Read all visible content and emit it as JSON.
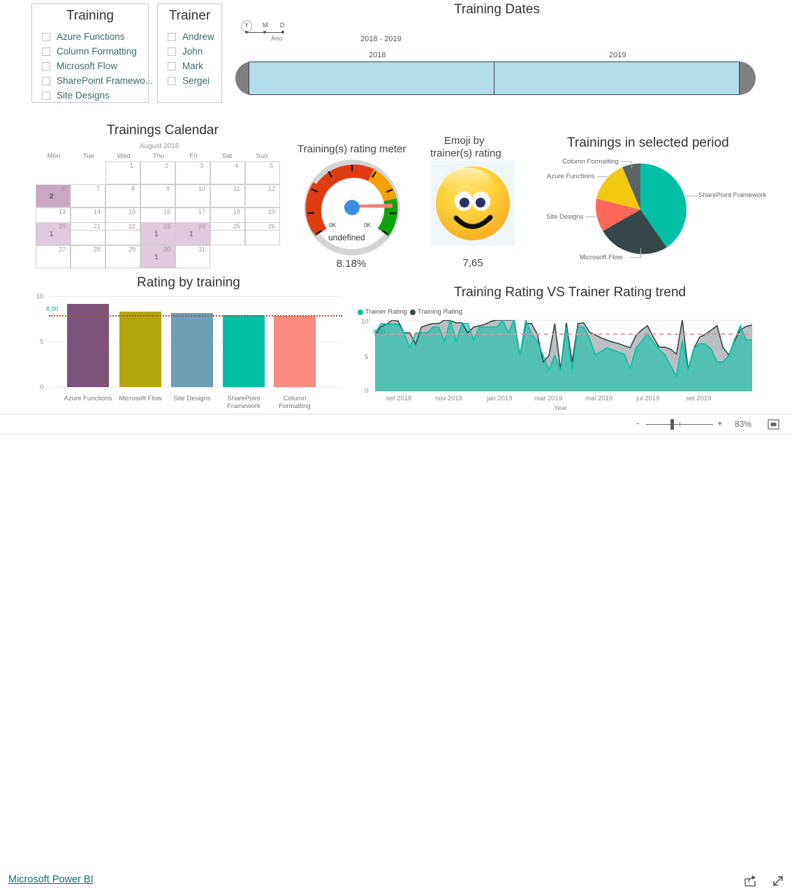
{
  "slicers": {
    "training": {
      "title": "Training",
      "items": [
        "Azure Functions",
        "Column Formatting",
        "Microsoft Flow",
        "SharePoint Framewo...",
        "Site Designs"
      ]
    },
    "trainer": {
      "title": "Trainer",
      "items": [
        "Andrew",
        "John",
        "Mark",
        "Sergei"
      ]
    }
  },
  "timeline": {
    "title": "Training Dates",
    "granularity": {
      "options": [
        "Y",
        "M",
        "D"
      ],
      "selected": "Y",
      "label": "Ano"
    },
    "range": "2018 - 2019",
    "periods": [
      "2018",
      "2019"
    ]
  },
  "calendar": {
    "title": "Trainings Calendar",
    "month": "August 2018",
    "dow": [
      "Mon",
      "Tue",
      "Wed",
      "Thu",
      "Fri",
      "Sat",
      "Sun"
    ],
    "weeks": [
      [
        null,
        null,
        1,
        2,
        3,
        4,
        5
      ],
      [
        6,
        7,
        8,
        9,
        10,
        11,
        12
      ],
      [
        13,
        14,
        15,
        16,
        17,
        18,
        19
      ],
      [
        20,
        21,
        22,
        23,
        24,
        25,
        26
      ],
      [
        27,
        28,
        29,
        30,
        31,
        null,
        null
      ]
    ],
    "counts": {
      "6": 2,
      "20": 1,
      "23": 1,
      "24": 1,
      "30": 1
    }
  },
  "gauge": {
    "title": "Training(s) rating meter",
    "min_label": "0K",
    "max_label": "0K",
    "center_label": "undefined",
    "value": "8.18%"
  },
  "emoji": {
    "title_line1": "Emoji by",
    "title_line2": "trainer(s) rating",
    "value": "7,65",
    "icon": "smiley-face"
  },
  "pie": {
    "title": "Trainings in selected period"
  },
  "bars": {
    "title": "Rating by training"
  },
  "trend": {
    "title": "Training Rating VS Trainer Rating trend"
  },
  "statusbar": {
    "zoom_out": "-",
    "zoom_in": "+",
    "zoom_level": "83%",
    "fit_icon": "fit-to-page-icon"
  },
  "footer": {
    "brand": "Microsoft Power BI",
    "share_icon": "share-icon",
    "fullscreen_icon": "fullscreen-icon"
  },
  "chart_data": [
    {
      "type": "pie",
      "title": "Trainings in selected period",
      "labels": [
        "SharePoint Framework",
        "Microsoft Flow",
        "Site Designs",
        "Azure Functions",
        "Column Formatting"
      ],
      "values": [
        40,
        22,
        14,
        16,
        8
      ],
      "colors": [
        "#00bfa5",
        "#374649",
        "#fb685b",
        "#f2c811",
        "#5a6366"
      ],
      "legend": "labels-outside"
    },
    {
      "type": "bar",
      "title": "Rating by training",
      "categories": [
        "Azure Functions",
        "Microsoft Flow",
        "Site Designs",
        "SharePoint Framework",
        "Column Formatting"
      ],
      "values": [
        9.2,
        8.35,
        8.25,
        8.1,
        8.05
      ],
      "colors": [
        "#7d5379",
        "#b5a50d",
        "#6ba0b5",
        "#00bfa5",
        "#fb8a80"
      ],
      "ylabel": "",
      "xlabel": "",
      "ylim": [
        0,
        10
      ],
      "yticks": [
        0,
        5,
        10
      ],
      "reference_line": {
        "value": 8.0,
        "label": "8,00",
        "color": "#a0522d"
      },
      "grid": true
    },
    {
      "type": "area",
      "title": "Training Rating VS Trainer Rating trend",
      "xlabel": "Year",
      "ylabel": "",
      "ylim": [
        0,
        10
      ],
      "yticks": [
        0,
        5,
        10
      ],
      "xticks": [
        "set 2018",
        "nov 2018",
        "jan 2019",
        "mar 2019",
        "mai 2019",
        "jul 2019",
        "set 2019"
      ],
      "reference_line": {
        "value": 8.0,
        "label": "8,00",
        "color": "#e09a92"
      },
      "legend": [
        "Trainer Rating",
        "Training Rating"
      ],
      "series": [
        {
          "name": "Trainer Rating",
          "color": "#00bfa5",
          "values": [
            8.2,
            9.5,
            9.4,
            9.4,
            9.4,
            8.2,
            6.1,
            8.2,
            8.2,
            8.2,
            9.0,
            9.0,
            7.0,
            10.0,
            7.0,
            9.5,
            9.5,
            7.2,
            9.0,
            9.0,
            9.0,
            9.0,
            10.0,
            8.2,
            10.0,
            5.0,
            10.0,
            8.0,
            7.0,
            5.0,
            3.0,
            5.0,
            3.0,
            9.0,
            3.0,
            9.0,
            9.0,
            7.4,
            5.1,
            5.6,
            6.1,
            5.8,
            5.5,
            5.2,
            3.1,
            6.0,
            7.0,
            8.1,
            6.9,
            5.9,
            5.1,
            3.6,
            2.1,
            7.1,
            3.0,
            6.0,
            6.7,
            6.6,
            5.9,
            4.1,
            4.1,
            5.0,
            7.2,
            9.2,
            7.1,
            7.2
          ]
        },
        {
          "name": "Training Rating",
          "color": "#374649",
          "values": [
            7.8,
            9.2,
            9.5,
            10.0,
            9.8,
            8.2,
            8.2,
            6.6,
            9.0,
            9.3,
            9.5,
            9.5,
            10.0,
            9.9,
            9.6,
            9.6,
            8.2,
            9.0,
            9.2,
            9.4,
            9.8,
            10.0,
            10.0,
            10.0,
            10.0,
            5.1,
            9.5,
            9.5,
            8.0,
            4.1,
            5.0,
            9.5,
            3.1,
            9.6,
            4.1,
            9.5,
            9.6,
            8.3,
            7.9,
            7.5,
            7.2,
            6.9,
            6.7,
            6.4,
            6.1,
            7.8,
            8.6,
            9.2,
            7.6,
            6.2,
            6.2,
            5.9,
            5.2,
            10.0,
            3.1,
            6.0,
            7.6,
            8.0,
            8.6,
            9.2,
            6.0,
            5.1,
            7.0,
            8.6,
            9.1,
            9.3
          ]
        }
      ]
    }
  ]
}
